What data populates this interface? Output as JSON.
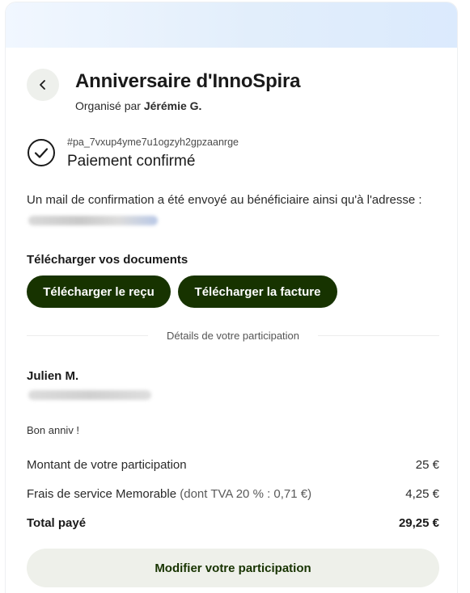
{
  "event": {
    "title": "Anniversaire d'InnoSpira",
    "organizer_prefix": "Organisé par",
    "organizer_name": "Jérémie G."
  },
  "payment": {
    "reference": "#pa_7vxup4yme7u1ogzyh2gpzaanrge",
    "status": "Paiement confirmé"
  },
  "confirmation": {
    "text": "Un mail de confirmation a été envoyé au bénéficiaire ainsi qu'à l'adresse :"
  },
  "documents": {
    "title": "Télécharger vos documents",
    "receipt_label": "Télécharger le reçu",
    "invoice_label": "Télécharger la facture"
  },
  "participation": {
    "section_label": "Détails de votre participation",
    "participant_name": "Julien M.",
    "message": "Bon anniv !",
    "amount_label": "Montant de votre participation",
    "amount_value": "25 €",
    "fees_label": "Frais de service Memorable",
    "fees_detail": "(dont TVA 20 % : 0,71 €)",
    "fees_value": "4,25 €",
    "total_label": "Total payé",
    "total_value": "29,25 €",
    "edit_label": "Modifier votre participation"
  },
  "colors": {
    "primary_dark": "#173300",
    "light_button": "#eef0ea",
    "banner_start": "#f1f7ff",
    "banner_end": "#dbeafd"
  },
  "icons": {
    "back": "chevron-left-icon",
    "status": "check-circle-icon"
  }
}
